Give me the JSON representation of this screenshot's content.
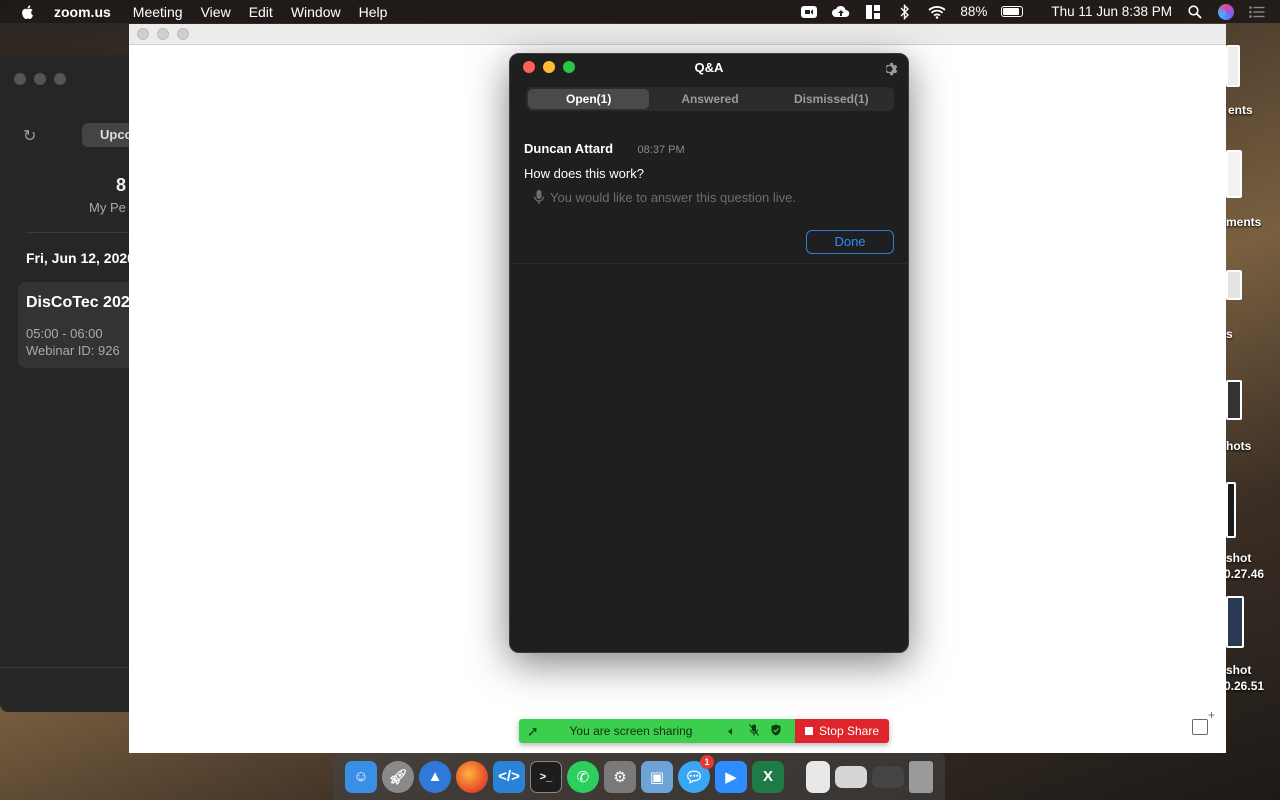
{
  "menubar": {
    "app_name": "zoom.us",
    "menus": [
      "Meeting",
      "View",
      "Edit",
      "Window",
      "Help"
    ],
    "battery": "88%",
    "datetime": "Thu 11 Jun  8:38 PM"
  },
  "desktop": {
    "labels": [
      "ents",
      "ments",
      "s",
      "hots",
      "shot",
      "0.27.46",
      "shot",
      "0.26.51"
    ]
  },
  "zoom_main": {
    "tab_label": "Upco",
    "big_number": "8",
    "meeting_id_label": "My Pe",
    "date_header": "Fri, Jun 12, 2020",
    "card": {
      "title": "DisCoTec 202",
      "time": "05:00 - 06:00",
      "webinar_id": "Webinar ID: 926"
    }
  },
  "qa": {
    "title": "Q&A",
    "tabs": [
      {
        "label": "Open(1)",
        "active": true
      },
      {
        "label": "Answered",
        "active": false
      },
      {
        "label": "Dismissed(1)",
        "active": false
      }
    ],
    "question": {
      "author": "Duncan Attard",
      "time": "08:37 PM",
      "text": "How does this work?",
      "live_note": "You would like to answer this question live."
    },
    "done_label": "Done"
  },
  "share_bar": {
    "message": "You are screen sharing",
    "stop_label": "Stop Share",
    "green_color": "#3ccf4e",
    "red_color": "#e0242c"
  },
  "dock": {
    "apps": [
      {
        "icon": "finder-icon",
        "color": "#3a8ee6"
      },
      {
        "icon": "launchpad-icon",
        "color": "#8a8a8a"
      },
      {
        "icon": "spark-icon",
        "color": "#2f7ad9"
      },
      {
        "icon": "firefox-icon",
        "color": "#f0731f"
      },
      {
        "icon": "vscode-icon",
        "color": "#2a83d6"
      },
      {
        "icon": "terminal-icon",
        "color": "#1d1d1d"
      },
      {
        "icon": "whatsapp-icon",
        "color": "#2ccf5e"
      },
      {
        "icon": "system-preferences-icon",
        "color": "#7a7a7a"
      },
      {
        "icon": "preview-icon",
        "color": "#6ea3d6"
      },
      {
        "icon": "messages-icon",
        "color": "#3aa7f5",
        "badge": "1"
      },
      {
        "icon": "zoom-icon",
        "color": "#2d8cff"
      },
      {
        "icon": "excel-icon",
        "color": "#1f7a45"
      }
    ],
    "docs": [
      {
        "icon": "document-icon",
        "color": "#e8e8e8"
      },
      {
        "icon": "screenshot-icon",
        "color": "#d6d6d6"
      },
      {
        "icon": "downloads-icon",
        "color": "#444444"
      },
      {
        "icon": "trash-icon",
        "color": "#9a9a9a"
      }
    ]
  }
}
